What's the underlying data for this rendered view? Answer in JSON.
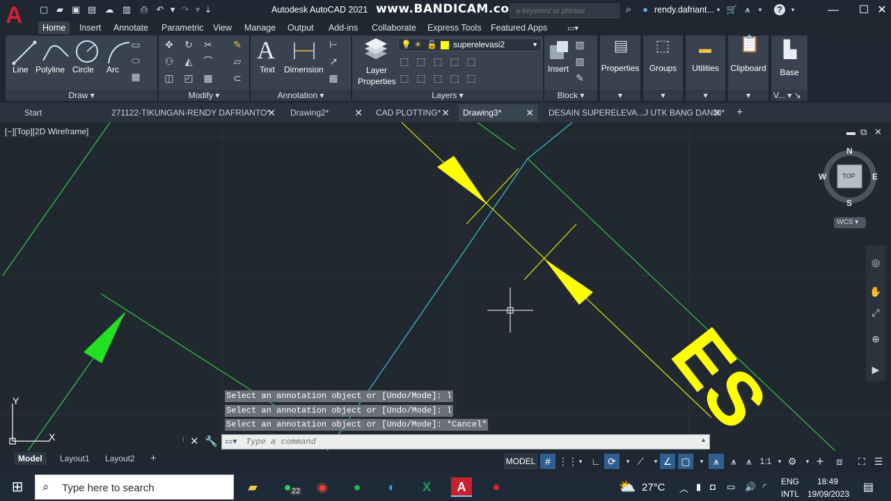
{
  "title_bar": {
    "app_title": "Autodesk AutoCAD 2021",
    "bracket": "[",
    "watermark": "www.BANDICAM.com",
    "search_placeholder": "a keyword or phrase",
    "user_name": "rendy.dafriant...",
    "help": "?",
    "window_controls": {
      "minimize": "—",
      "maximize": "☐",
      "close": "✕"
    }
  },
  "ribbon_tabs": [
    {
      "label": "Home",
      "active": true
    },
    {
      "label": "Insert"
    },
    {
      "label": "Annotate"
    },
    {
      "label": "Parametric"
    },
    {
      "label": "View"
    },
    {
      "label": "Manage"
    },
    {
      "label": "Output"
    },
    {
      "label": "Add-ins"
    },
    {
      "label": "Collaborate"
    },
    {
      "label": "Express Tools"
    },
    {
      "label": "Featured Apps"
    }
  ],
  "ribbon": {
    "draw": {
      "panel": "Draw",
      "line": "Line",
      "polyline": "Polyline",
      "circle": "Circle",
      "arc": "Arc"
    },
    "modify": {
      "panel": "Modify"
    },
    "annotation": {
      "panel": "Annotation",
      "text": "Text",
      "dimension": "Dimension"
    },
    "layers": {
      "panel": "Layers",
      "layer_properties_1": "Layer",
      "layer_properties_2": "Properties",
      "current_layer": "superelevasi2",
      "layer_color": "#ffff00"
    },
    "block": {
      "panel": "Block",
      "insert": "Insert"
    },
    "properties": "Properties",
    "groups": "Groups",
    "utilities": "Utilities",
    "clipboard": "Clipboard",
    "view": {
      "base": "Base",
      "panel": "V..."
    }
  },
  "file_tabs": [
    {
      "label": "Start",
      "closable": false
    },
    {
      "label": "271122-TIKUNGAN-RENDY DAFRIANTO*",
      "closable": true
    },
    {
      "label": "Drawing2*",
      "closable": true
    },
    {
      "label": "CAD PLOTTING*",
      "closable": true
    },
    {
      "label": "Drawing3*",
      "closable": true,
      "active": true
    },
    {
      "label": "DESAIN SUPERELEVA...J UTK BANG DANDI*",
      "closable": true
    }
  ],
  "viewport": {
    "label": "[−][Top][2D Wireframe]",
    "drawing_text": "ES",
    "viewcube": {
      "top": "TOP",
      "n": "N",
      "s": "S",
      "e": "E",
      "w": "W",
      "wcs": "WCS"
    },
    "ucs": {
      "x": "X",
      "y": "Y"
    }
  },
  "command": {
    "history": [
      "Select an annotation object or [Undo/Mode]: l",
      "Select an annotation object or [Undo/Mode]: l",
      "Select an annotation object or [Undo/Mode]: *Cancel*"
    ],
    "placeholder": "Type a command"
  },
  "layout_tabs": [
    {
      "label": "Model",
      "active": true
    },
    {
      "label": "Layout1"
    },
    {
      "label": "Layout2"
    }
  ],
  "status_bar": {
    "model": "MODEL",
    "scale": "1:1"
  },
  "taskbar": {
    "search_placeholder": "Type here to search",
    "whatsapp_badge": "22",
    "weather": "27°C",
    "lang_1": "ENG",
    "lang_2": "INTL",
    "time": "18:49",
    "date": "19/09/2023"
  }
}
